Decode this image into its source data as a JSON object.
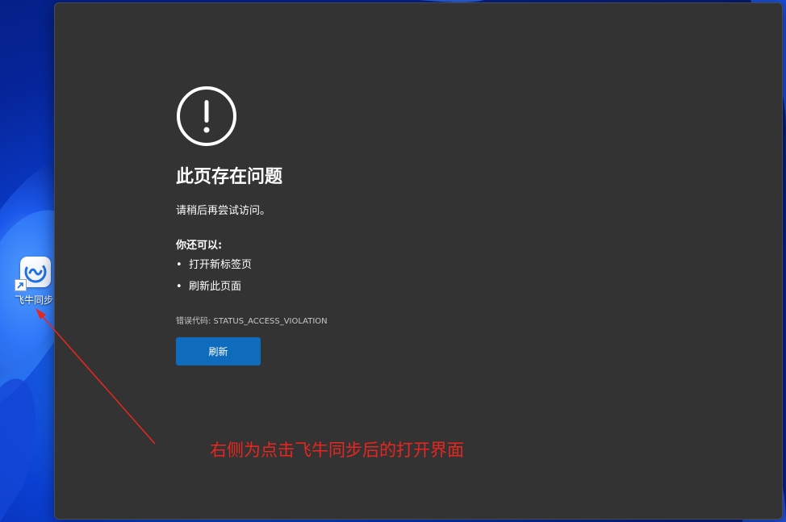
{
  "desktop": {
    "icon_label": "飞牛同步",
    "icon_name": "feiniu-sync-icon"
  },
  "error_page": {
    "title": "此页存在问题",
    "subtitle": "请稍后再尝试访问。",
    "options_heading": "你还可以:",
    "options": [
      "打开新标签页",
      "刷新此页面"
    ],
    "error_code": "错误代码: STATUS_ACCESS_VIOLATION",
    "refresh_label": "刷新"
  },
  "annotation": {
    "text": "右侧为点击飞牛同步后的打开界面",
    "color": "#e8261f"
  },
  "colors": {
    "window_bg": "#333333",
    "button_bg": "#0f6cbd",
    "wallpaper_blue": "#0a3fd1"
  }
}
